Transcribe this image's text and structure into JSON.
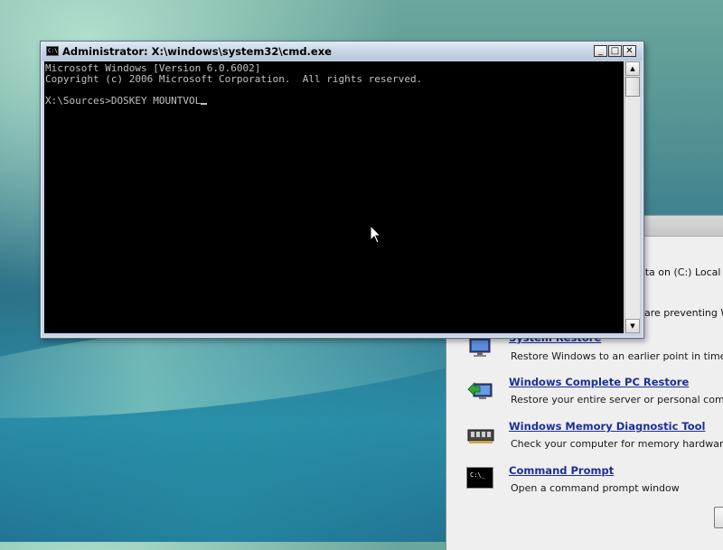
{
  "cmd_window": {
    "title": "Administrator: X:\\windows\\system32\\cmd.exe",
    "icon_text": "C:\\",
    "minimize_glyph": "_",
    "maximize_glyph": "□",
    "close_glyph": "✕",
    "console_lines": [
      "Microsoft Windows [Version 6.0.6002]",
      "Copyright (c) 2006 Microsoft Corporation.  All rights reserved.",
      "",
      "X:\\Sources>DOSKEY MOUNTVOL"
    ],
    "scroll_up_glyph": "▲",
    "scroll_down_glyph": "▼"
  },
  "recovery_panel": {
    "partial_line_1": "sta on (C:) Local Di",
    "partial_line_2": "are preventing W",
    "options": [
      {
        "link": "System Restore",
        "desc": "Restore Windows to an earlier point in time",
        "icon": "system-restore-icon"
      },
      {
        "link": "Windows Complete PC Restore",
        "desc": "Restore your entire server or personal computer",
        "icon": "pc-restore-icon"
      },
      {
        "link": "Windows Memory Diagnostic Tool",
        "desc": "Check your computer for memory hardware erro",
        "icon": "memory-chip-icon"
      },
      {
        "link": "Command Prompt",
        "desc": "Open a command prompt window",
        "icon": "command-prompt-icon"
      }
    ],
    "cmd_icon_text": "C:\\_"
  },
  "colors": {
    "console_bg": "#000000",
    "console_fg": "#c0c0c0",
    "link": "#1a2f9a",
    "panel_bg": "#efefef"
  }
}
